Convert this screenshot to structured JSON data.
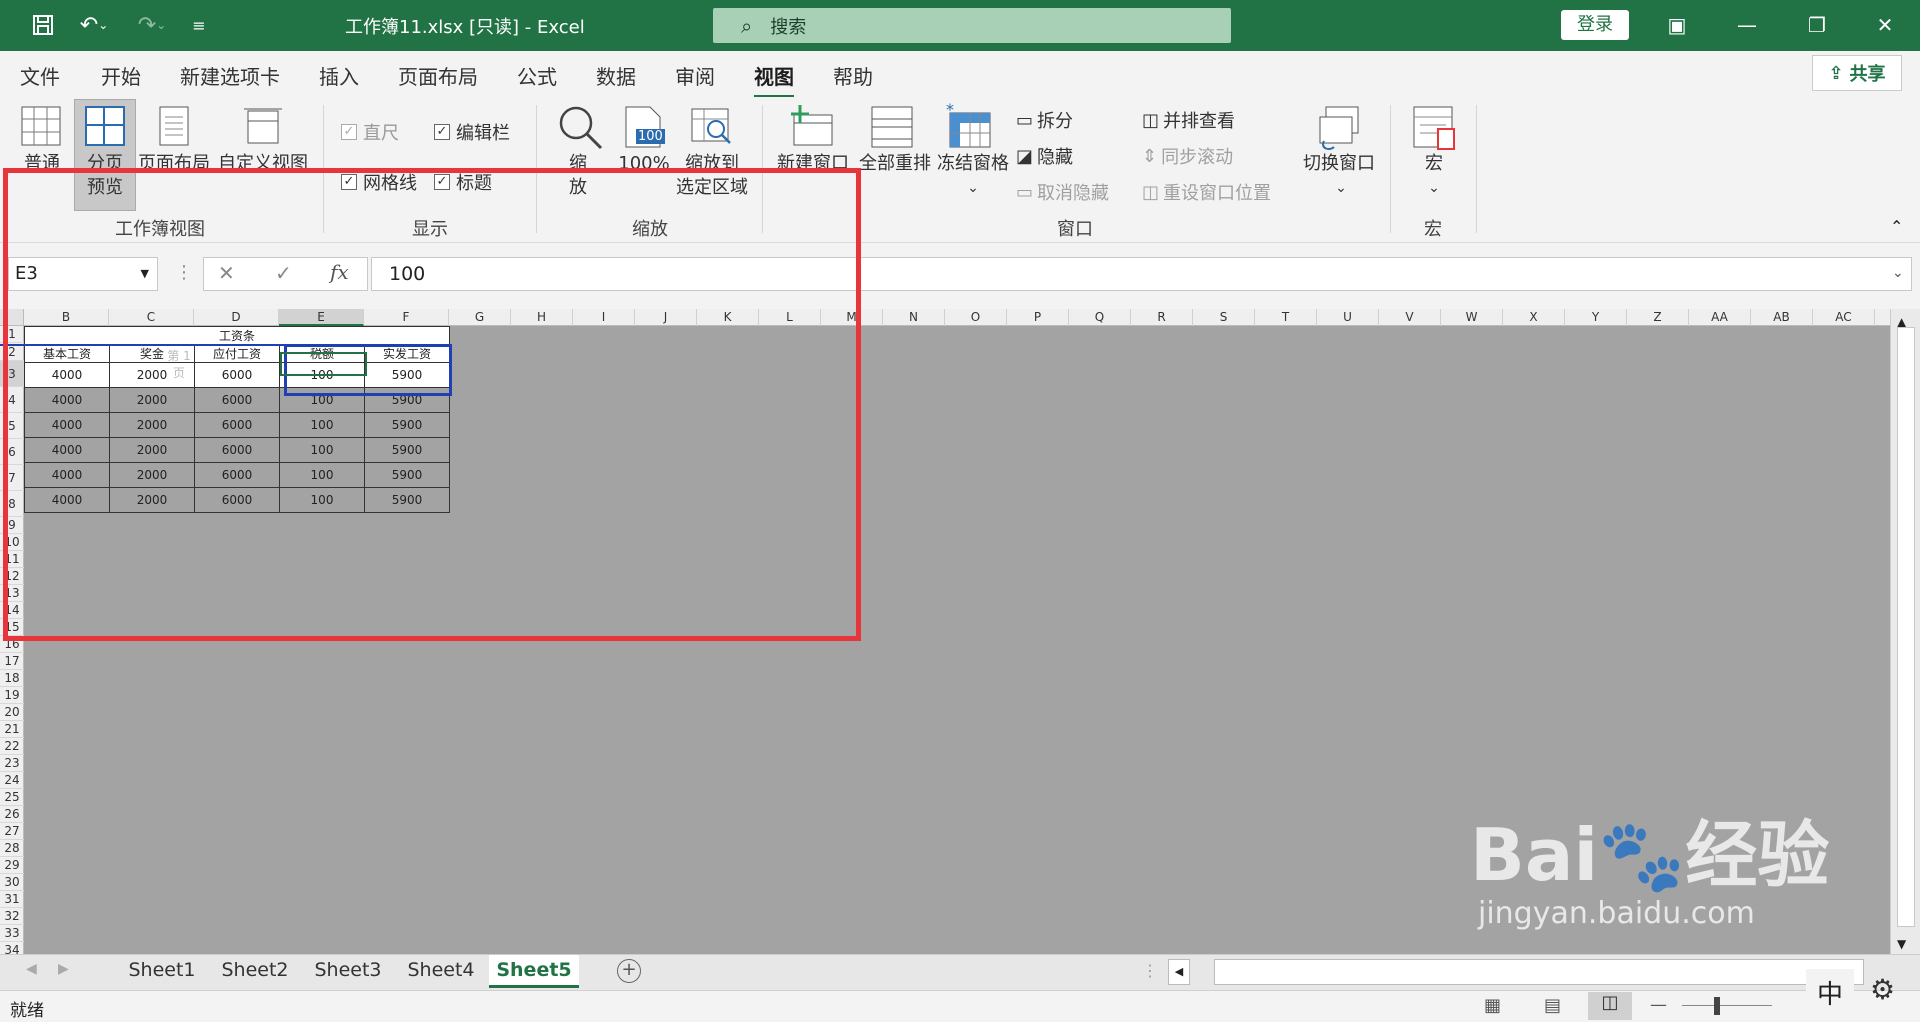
{
  "titlebar": {
    "title": "工作簿11.xlsx  [只读]  -  Excel",
    "search_placeholder": "搜索",
    "login": "登录"
  },
  "tabs": [
    "文件",
    "开始",
    "新建选项卡",
    "插入",
    "页面布局",
    "公式",
    "数据",
    "审阅",
    "视图",
    "帮助"
  ],
  "active_tab": "视图",
  "share": "共享",
  "ribbon": {
    "workbook_views": {
      "normal": "普通",
      "pagebreak_1": "分页",
      "pagebreak_2": "预览",
      "page_layout": "页面布局",
      "custom_views": "自定义视图",
      "group": "工作簿视图"
    },
    "show": {
      "ruler": "直尺",
      "formula_bar": "编辑栏",
      "gridlines": "网格线",
      "headings": "标题",
      "group": "显示"
    },
    "zoom": {
      "zoom_1": "缩",
      "zoom_2": "放",
      "hundred": "100%",
      "hundred_badge": "100",
      "to_sel_1": "缩放到",
      "to_sel_2": "选定区域",
      "group": "缩放"
    },
    "window": {
      "new_window": "新建窗口",
      "arrange_all": "全部重排",
      "freeze": "冻结窗格",
      "split": "拆分",
      "hide": "隐藏",
      "unhide": "取消隐藏",
      "side_by_side": "并排查看",
      "sync_scroll": "同步滚动",
      "reset_pos": "重设窗口位置",
      "switch": "切换窗口",
      "group": "窗口"
    },
    "macros": {
      "macros": "宏",
      "group": "宏"
    }
  },
  "formula_bar": {
    "name_box": "E3",
    "formula": "100",
    "fx": "fx"
  },
  "sheet": {
    "columns": [
      "B",
      "C",
      "D",
      "E",
      "F",
      "G",
      "H",
      "I",
      "J",
      "K",
      "L",
      "M",
      "N",
      "O",
      "P",
      "Q",
      "R",
      "S",
      "T",
      "U",
      "V",
      "W",
      "X",
      "Y",
      "Z",
      "AA",
      "AB",
      "AC"
    ],
    "rows": [
      "1",
      "2",
      "3",
      "4",
      "5",
      "6",
      "7",
      "8",
      "9",
      "10",
      "11",
      "12",
      "13",
      "14",
      "15",
      "16",
      "17",
      "18",
      "19",
      "20",
      "21",
      "22",
      "23",
      "24",
      "25",
      "26",
      "27",
      "28",
      "29",
      "30",
      "31",
      "32",
      "33",
      "34"
    ],
    "title": "工资条",
    "headers": [
      "基本工资",
      "奖金",
      "应付工资",
      "税额",
      "实发工资"
    ],
    "page_label": "第 1 页",
    "data_rows": [
      [
        "4000",
        "2000",
        "6000",
        "100",
        "5900"
      ],
      [
        "4000",
        "2000",
        "6000",
        "100",
        "5900"
      ],
      [
        "4000",
        "2000",
        "6000",
        "100",
        "5900"
      ],
      [
        "4000",
        "2000",
        "6000",
        "100",
        "5900"
      ],
      [
        "4000",
        "2000",
        "6000",
        "100",
        "5900"
      ],
      [
        "4000",
        "2000",
        "6000",
        "100",
        "5900"
      ]
    ]
  },
  "sheet_tabs": [
    "Sheet1",
    "Sheet2",
    "Sheet3",
    "Sheet4",
    "Sheet5"
  ],
  "active_sheet": "Sheet5",
  "status": {
    "ready": "就绪",
    "ime": "中"
  },
  "watermark": {
    "brand": "Bai",
    "brand2": "经验",
    "url": "jingyan.baidu.com"
  },
  "colors": {
    "excel_green": "#217346",
    "highlight": "#e8353b"
  }
}
